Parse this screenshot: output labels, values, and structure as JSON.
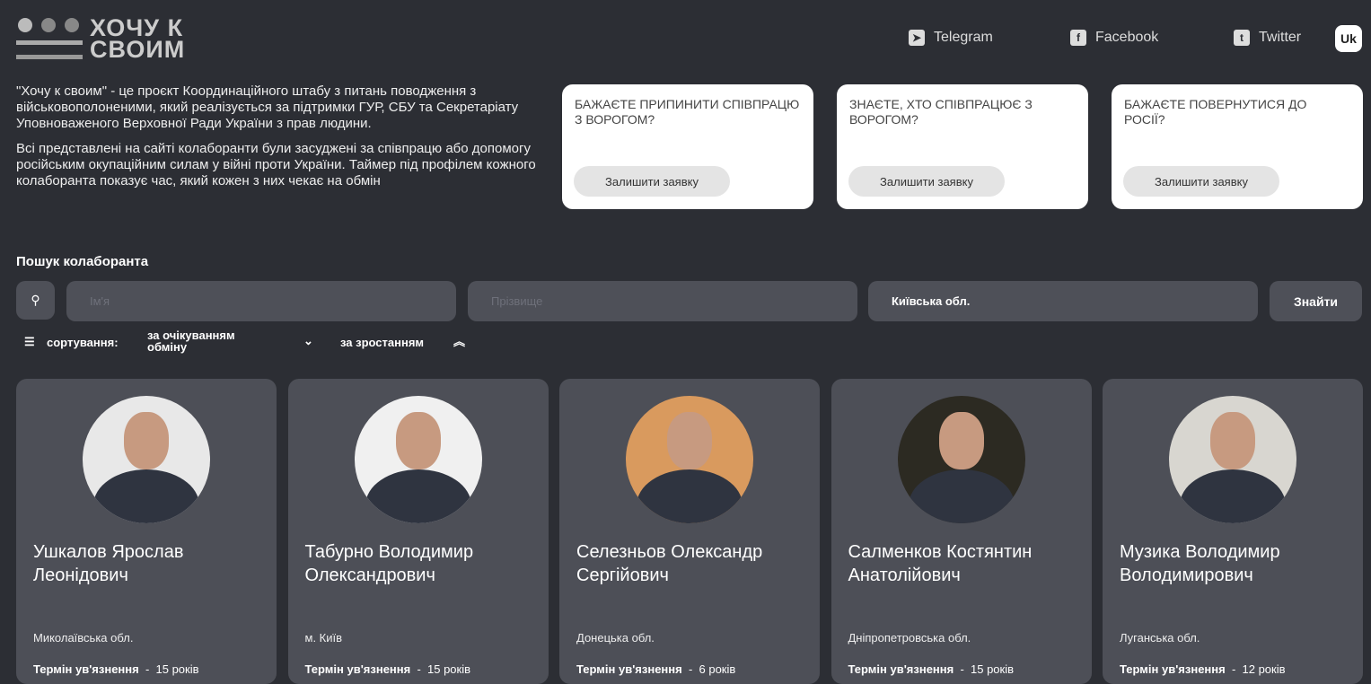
{
  "logo": {
    "line1": "ХОЧУ К",
    "line2": "СВОИМ"
  },
  "social": [
    {
      "label": "Telegram",
      "icon": "telegram-icon"
    },
    {
      "label": "Facebook",
      "icon": "facebook-icon"
    },
    {
      "label": "Twitter",
      "icon": "twitter-icon"
    }
  ],
  "lang": "Uk",
  "intro": {
    "p1": "\"Хочу к своим\" - це проєкт Координаційного штабу з питань поводження з військовополоненими, який реалізується за підтримки ГУР, СБУ та Секретаріату Уповноваженого Верховної Ради України з прав людини.",
    "p2": "Всі представлені на сайті колаборанти були засуджені за співпрацю або допомогу російським окупаційним силам у війні проти України. Таймер під профілем кожного колаборанта показує час, який кожен з них чекає на обмін"
  },
  "cta": [
    {
      "question": "Бажаєте припинити співпрацю з ворогом?",
      "button": "Залишити заявку"
    },
    {
      "question": "Знаєте, хто співпрацює з ворогом?",
      "button": "Залишити заявку"
    },
    {
      "question": "Бажаєте повернутися до Росії?",
      "button": "Залишити заявку"
    }
  ],
  "search": {
    "title": "Пошук колаборанта",
    "first_name_placeholder": "Ім'я",
    "last_name_placeholder": "Прізвище",
    "region": "Київська обл.",
    "find": "Знайти"
  },
  "sort": {
    "label": "сортування:",
    "by": "за очікуванням обміну",
    "order": "за зростанням"
  },
  "term_label": "Термін ув'язнення",
  "cards": [
    {
      "name": "Ушкалов Ярослав Леонідович",
      "region": "Миколаївська обл.",
      "term": "15 років",
      "bg": "#e8e8e8"
    },
    {
      "name": "Табурно Володимир Олександрович",
      "region": "м. Київ",
      "term": "15 років",
      "bg": "#f0f0f0"
    },
    {
      "name": "Селезньов Олександр Сергійович",
      "region": "Донецька обл.",
      "term": "6 років",
      "bg": "#d99a5e"
    },
    {
      "name": "Салменков Костянтин Анатолійович",
      "region": "Дніпропетровська обл.",
      "term": "15 років",
      "bg": "#2c2a22"
    },
    {
      "name": "Музика Володимир Володимирович",
      "region": "Луганська обл.",
      "term": "12 років",
      "bg": "#d8d6d0"
    }
  ]
}
